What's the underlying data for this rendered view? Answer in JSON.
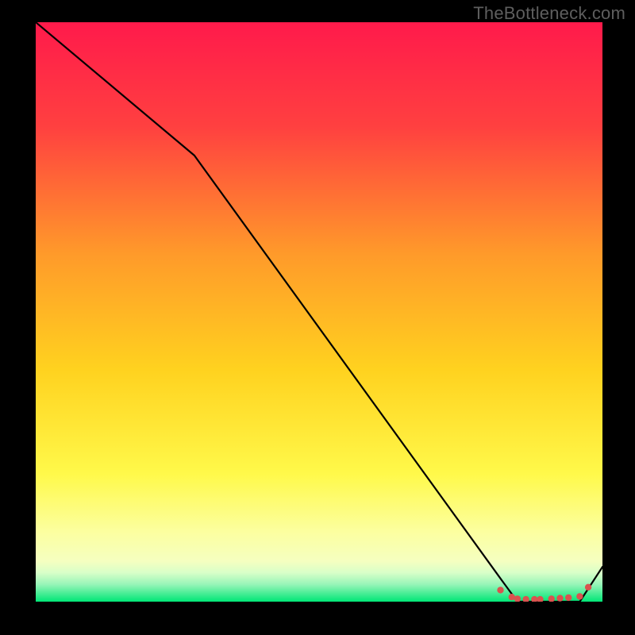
{
  "watermark": "TheBottleneck.com",
  "colors": {
    "page_bg": "#000000",
    "watermark": "#5e5e5e",
    "gradient_top": "#ff1a4b",
    "gradient_mid1": "#ff7a2a",
    "gradient_mid2": "#ffd21f",
    "gradient_mid3": "#fff94a",
    "gradient_low": "#f5ffb0",
    "gradient_bottom": "#00e676",
    "line": "#000000",
    "marker": "#d9534f"
  },
  "chart_data": {
    "type": "line",
    "title": "",
    "xlabel": "",
    "ylabel": "",
    "xlim": [
      0,
      100
    ],
    "ylim": [
      0,
      100
    ],
    "series": [
      {
        "name": "curve",
        "x": [
          0,
          28,
          82,
          85,
          96,
          100
        ],
        "y": [
          100,
          77,
          4,
          0,
          0,
          6
        ]
      }
    ],
    "markers": {
      "name": "flat-segment-dots",
      "points": [
        {
          "x": 82,
          "y": 2
        },
        {
          "x": 84,
          "y": 0.8
        },
        {
          "x": 85,
          "y": 0.5
        },
        {
          "x": 86.5,
          "y": 0.4
        },
        {
          "x": 88,
          "y": 0.4
        },
        {
          "x": 89,
          "y": 0.4
        },
        {
          "x": 91,
          "y": 0.5
        },
        {
          "x": 92.5,
          "y": 0.6
        },
        {
          "x": 94,
          "y": 0.7
        },
        {
          "x": 96,
          "y": 0.9
        },
        {
          "x": 97.5,
          "y": 2.5
        }
      ]
    }
  }
}
